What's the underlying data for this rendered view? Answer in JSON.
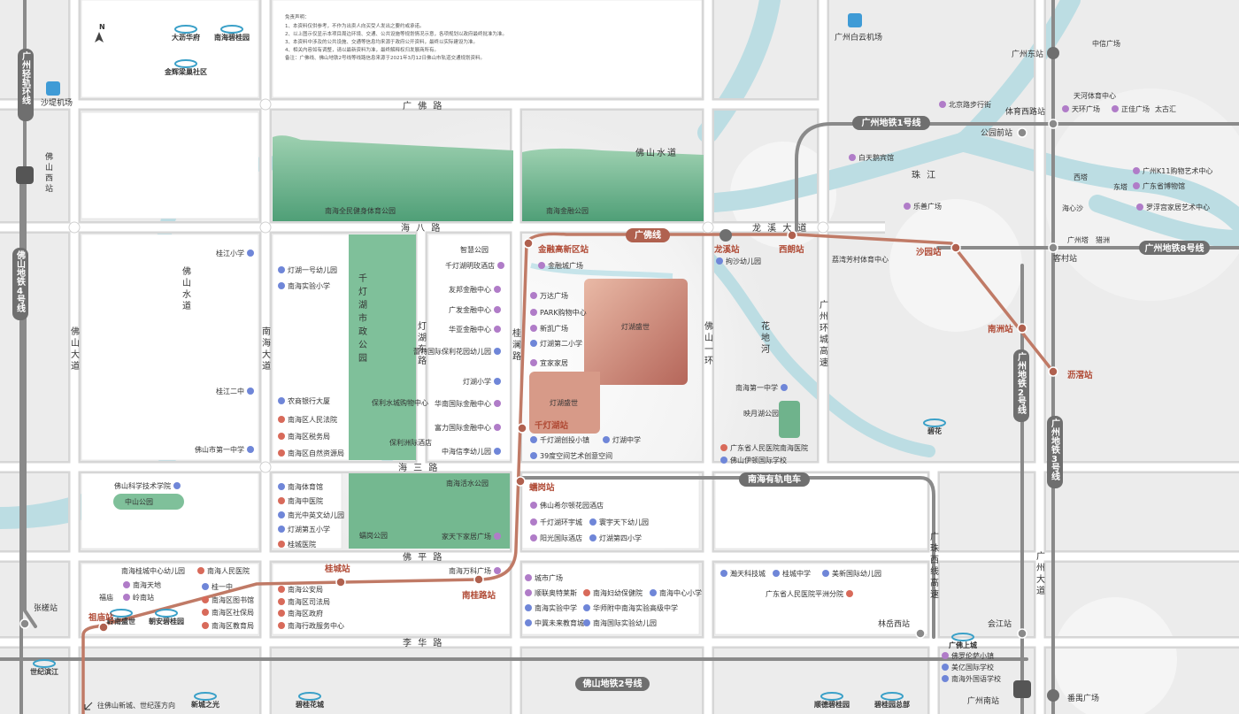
{
  "legal": {
    "heading": "免责声明：",
    "lines": [
      "1、本资料仅供参考，不作为出卖人向买受人发出之要约或承诺。",
      "2、以上图示仅显示本项目周边环境、交通、公共设施等规划情况示意，各项规划以政府最终批准为准。",
      "3、本资料中涉及的公共设施、交通等信息均来源于政府公开资料，最终以实际建设为准。",
      "4、相关内容如有调整，请以最新资料为准，最终解释权归发展商所有。",
      "备注：广佛线、佛山地铁2号线等线路信息来源于2021年3月12日佛山市轨道交通规划资料。"
    ]
  },
  "brands": [
    "大沥华府",
    "南海碧桂园",
    "金辉梁巢社区",
    "岭南盛世",
    "朝安碧桂园",
    "世纪滨江",
    "新城之光",
    "碧桂花城",
    "顺德碧桂园",
    "碧桂园总部",
    "广佛上城",
    "碧花"
  ],
  "compass": "N",
  "project": {
    "name": "灯湖盛世",
    "sub": "灯湖盛世"
  },
  "roads": {
    "h": [
      "广 佛 路",
      "海 八 路",
      "龙 溪 大 道",
      "海 三 路",
      "佛 平 路",
      "李 华 路"
    ],
    "v": [
      "佛山大道",
      "南海大道",
      "灯湖东路",
      "桂澜路",
      "佛山一环",
      "广州环城高速",
      "广珠西线高速",
      "广州大道",
      "佛山水道",
      "花地河"
    ]
  },
  "water": [
    "佛山水道",
    "珠 江",
    "海心沙",
    "花地河"
  ],
  "parks": [
    "南海全民健身体育公园",
    "南海金融公园",
    "千灯湖市政公园",
    "南海活水公园",
    "蠕岗公园",
    "中山公园",
    "映月湖公园",
    "智慧公园"
  ],
  "metro": {
    "lines": [
      "广州地铁1号线",
      "广佛线",
      "南海有轨电车",
      "佛山地铁2号线",
      "广州地铁8号线",
      "广州地铁2号线",
      "广州地铁3号线",
      "佛山地铁4号线",
      "广州轻轨环线"
    ],
    "stations_highlight": [
      "金融高新区站",
      "千灯湖站",
      "蠕岗站",
      "桂城站",
      "南桂路站",
      "祖庙站",
      "龙溪站",
      "西朗站",
      "沙园站",
      "南洲站",
      "沥滘站"
    ],
    "stations": [
      "张槎站",
      "佛山西站",
      "广州东站",
      "体育西路站",
      "公园前站",
      "客村站",
      "林岳西站",
      "会江站",
      "广州南站",
      "番禺广场",
      "沙堤机场",
      "广州白云机场"
    ]
  },
  "pois": {
    "center_east": [
      "金融城广场",
      "万达广场",
      "PARK购物中心",
      "新凯广场",
      "灯湖第二小学",
      "宜家家居",
      "千灯湖创投小镇",
      "灯湖中学",
      "39度空间艺术创意空间",
      "佛山希尔顿花园酒店",
      "千灯湖环宇城",
      "寰宇天下幼儿园",
      "阳光国际酒店",
      "灯湖第四小学"
    ],
    "center_west": [
      "千灯湖明玫酒店",
      "友邦金融中心",
      "广发金融中心",
      "华亚金融中心",
      "蕾特国际保利花园幼儿园",
      "灯湖小学",
      "华南国际金融中心",
      "富力国际金融中心",
      "中海信李幼儿园",
      "家天下家居广场",
      "南海万科广场",
      "保利水城购物中心",
      "保利洲际酒店"
    ],
    "west": [
      "灯湖一号幼儿园",
      "南海实验小学",
      "桂江小学",
      "桂江二中",
      "农商银行大厦",
      "南海区人民法院",
      "南海区税务局",
      "南海区自然资源局",
      "佛山市第一中学",
      "佛山科学技术学院",
      "南海体育馆",
      "南海中医院",
      "南光中英文幼儿园",
      "灯湖第五小学",
      "桂城医院"
    ],
    "south": [
      "南海桂城中心幼儿园",
      "南海人民医院",
      "南海天地",
      "岭南站",
      "桂一中",
      "南海区图书馆",
      "南海区社保局",
      "南海区教育局",
      "南海公安局",
      "南海区司法局",
      "南海区政府",
      "南海行政服务中心",
      "城市广场",
      "顺联奥特莱斯",
      "南海妇幼保健院",
      "南海中心小学",
      "南海实验中学",
      "华师附中南海实验高级中学",
      "中冀未来教育城",
      "南海国际实验幼儿园"
    ],
    "east": [
      "北京路步行街",
      "白天鹅宾馆",
      "乐善广场",
      "荔湾芳村体育中心",
      "拘沙幼儿园",
      "南海第一中学",
      "广东省人民医院南海医院",
      "佛山伊顿国际学校",
      "瀚天科技城",
      "桂城中学",
      "美新国际幼儿园",
      "广东省人民医院平洲分院",
      "天河体育中心",
      "中信广场",
      "天环广场",
      "正佳广场",
      "太古汇",
      "广州K11购物艺术中心",
      "广东省博物馆",
      "罗浮宫家居艺术中心",
      "广州塔",
      "猎洲",
      "西塔",
      "东塔",
      "佛罗伦萨小镇",
      "美亿国际学校",
      "南海外国语学校",
      "福庙"
    ]
  },
  "footer_direction": "往佛山新城、世纪莲方向"
}
